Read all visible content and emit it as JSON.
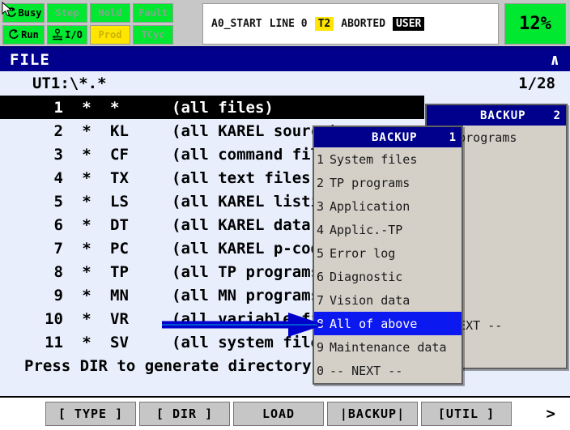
{
  "status_bar": {
    "leds": [
      {
        "label": "Busy",
        "state": "on",
        "icon": "cycle-icon"
      },
      {
        "label": "Step",
        "state": "off",
        "icon": null
      },
      {
        "label": "Hold",
        "state": "off",
        "icon": null
      },
      {
        "label": "Fault",
        "state": "off",
        "icon": null
      },
      {
        "label": "Run",
        "state": "on",
        "icon": "cycle-icon"
      },
      {
        "label": "I/O",
        "state": "on",
        "icon": "io-icon"
      },
      {
        "label": "Prod",
        "state": "prod",
        "icon": null
      },
      {
        "label": "TCyc",
        "state": "off",
        "icon": null
      }
    ],
    "message": {
      "program": "A0_START",
      "line": "LINE 0",
      "mode": "T2",
      "state": "ABORTED",
      "owner": "USER"
    },
    "override": "12%",
    "colors": {
      "led_on": "#00e830",
      "led_prod": "#ffe500",
      "highlight_yellow": "#ffe500",
      "highlight_black": "#000000"
    }
  },
  "title_bar": {
    "title": "FILE",
    "caret": "∧"
  },
  "path_line": {
    "path": "UT1:\\*.*",
    "page": "1/28"
  },
  "file_list": {
    "rows": [
      {
        "index": "1",
        "star": "*",
        "ext": "*",
        "desc": "(all files)",
        "selected": true
      },
      {
        "index": "2",
        "star": "*",
        "ext": "KL",
        "desc": "(all KAREL source)",
        "selected": false
      },
      {
        "index": "3",
        "star": "*",
        "ext": "CF",
        "desc": "(all command files)",
        "selected": false
      },
      {
        "index": "4",
        "star": "*",
        "ext": "TX",
        "desc": "(all text files)",
        "selected": false
      },
      {
        "index": "5",
        "star": "*",
        "ext": "LS",
        "desc": "(all KAREL listings)",
        "selected": false
      },
      {
        "index": "6",
        "star": "*",
        "ext": "DT",
        "desc": "(all KAREL data files)",
        "selected": false
      },
      {
        "index": "7",
        "star": "*",
        "ext": "PC",
        "desc": "(all KAREL p-code)",
        "selected": false
      },
      {
        "index": "8",
        "star": "*",
        "ext": "TP",
        "desc": "(all TP programs)",
        "selected": false
      },
      {
        "index": "9",
        "star": "*",
        "ext": "MN",
        "desc": "(all MN programs)",
        "selected": false
      },
      {
        "index": "10",
        "star": "*",
        "ext": "VR",
        "desc": "(all variable files)",
        "selected": false
      },
      {
        "index": "11",
        "star": "*",
        "ext": "SV",
        "desc": "(all system files)",
        "selected": false
      }
    ],
    "footer": "Press DIR to generate directory"
  },
  "popup_back": {
    "title": "BACKUP",
    "number": "2",
    "items": [
      {
        "key": "",
        "label": "All programs"
      },
      {
        "key": "",
        "label": ""
      },
      {
        "key": "",
        "label": ""
      },
      {
        "key": "",
        "label": ""
      },
      {
        "key": "",
        "label": ""
      },
      {
        "key": "",
        "label": ""
      },
      {
        "key": "",
        "label": ""
      },
      {
        "key": "",
        "label": ""
      },
      {
        "key": "",
        "label": "-- NEXT --"
      }
    ]
  },
  "popup_front": {
    "title": "BACKUP",
    "number": "1",
    "items": [
      {
        "key": "1",
        "label": "System files",
        "highlighted": false
      },
      {
        "key": "2",
        "label": "TP programs",
        "highlighted": false
      },
      {
        "key": "3",
        "label": "Application",
        "highlighted": false
      },
      {
        "key": "4",
        "label": "Applic.-TP",
        "highlighted": false
      },
      {
        "key": "5",
        "label": "Error log",
        "highlighted": false
      },
      {
        "key": "6",
        "label": "Diagnostic",
        "highlighted": false
      },
      {
        "key": "7",
        "label": "Vision data",
        "highlighted": false
      },
      {
        "key": "8",
        "label": "All of above",
        "highlighted": true
      },
      {
        "key": "9",
        "label": "Maintenance data",
        "highlighted": false
      },
      {
        "key": "0",
        "label": "-- NEXT --",
        "highlighted": false
      }
    ],
    "highlight_color": "#0b18f0"
  },
  "annotation": {
    "arrow_color": "#0000cc",
    "points_to": "All of above"
  },
  "function_keys": {
    "keys": [
      "[ TYPE ]",
      "[ DIR ]",
      "LOAD",
      "|BACKUP|",
      "[UTIL ]"
    ],
    "next": ">"
  }
}
